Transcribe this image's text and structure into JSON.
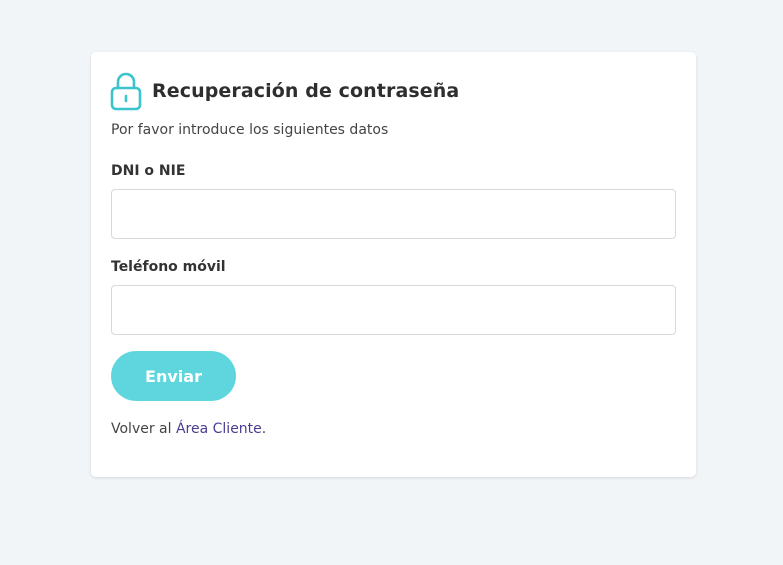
{
  "header": {
    "title": "Recuperación de contraseña",
    "icon": "lock-icon"
  },
  "subtitle": "Por favor introduce los siguientes datos",
  "form": {
    "dni_label": "DNI o NIE",
    "dni_value": "",
    "phone_label": "Teléfono móvil",
    "phone_value": "",
    "submit_label": "Enviar"
  },
  "footer": {
    "prefix": "Volver al ",
    "link_text": "Área Cliente",
    "suffix": "."
  },
  "colors": {
    "accent": "#5fd6dd",
    "icon": "#3cc4cc",
    "link": "#4b3d8f",
    "background": "#f2f5f8"
  }
}
